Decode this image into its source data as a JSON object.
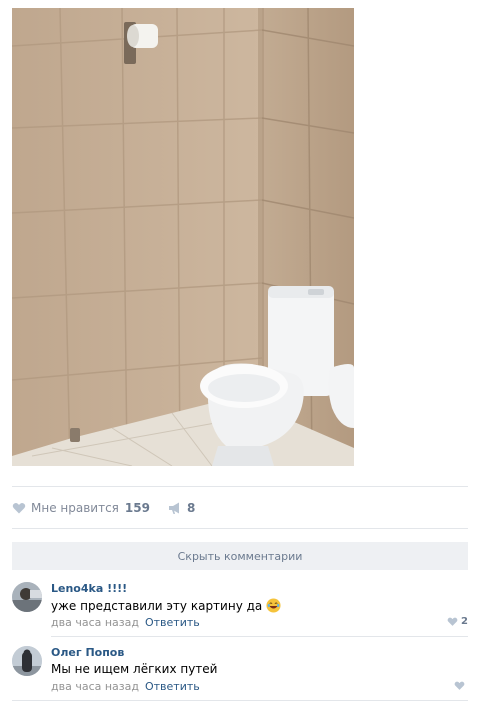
{
  "post": {
    "image_alt": "bathroom with toilet"
  },
  "actions": {
    "like_label": "Мне нравится",
    "like_count": "159",
    "share_count": "8"
  },
  "comments_toggle": "Скрыть комментарии",
  "comments": [
    {
      "author": "Leno4ka !!!!",
      "text": "уже представили эту картину да",
      "time": "два часа назад",
      "reply": "Ответить",
      "likes": "2"
    },
    {
      "author": "Олег Попов",
      "text": "Мы не ищем лёгких путей",
      "time": "два часа назад",
      "reply": "Ответить",
      "likes": ""
    }
  ],
  "colors": {
    "link": "#2a5885",
    "muted": "#828a99",
    "toggle_bg": "#eef0f3"
  }
}
